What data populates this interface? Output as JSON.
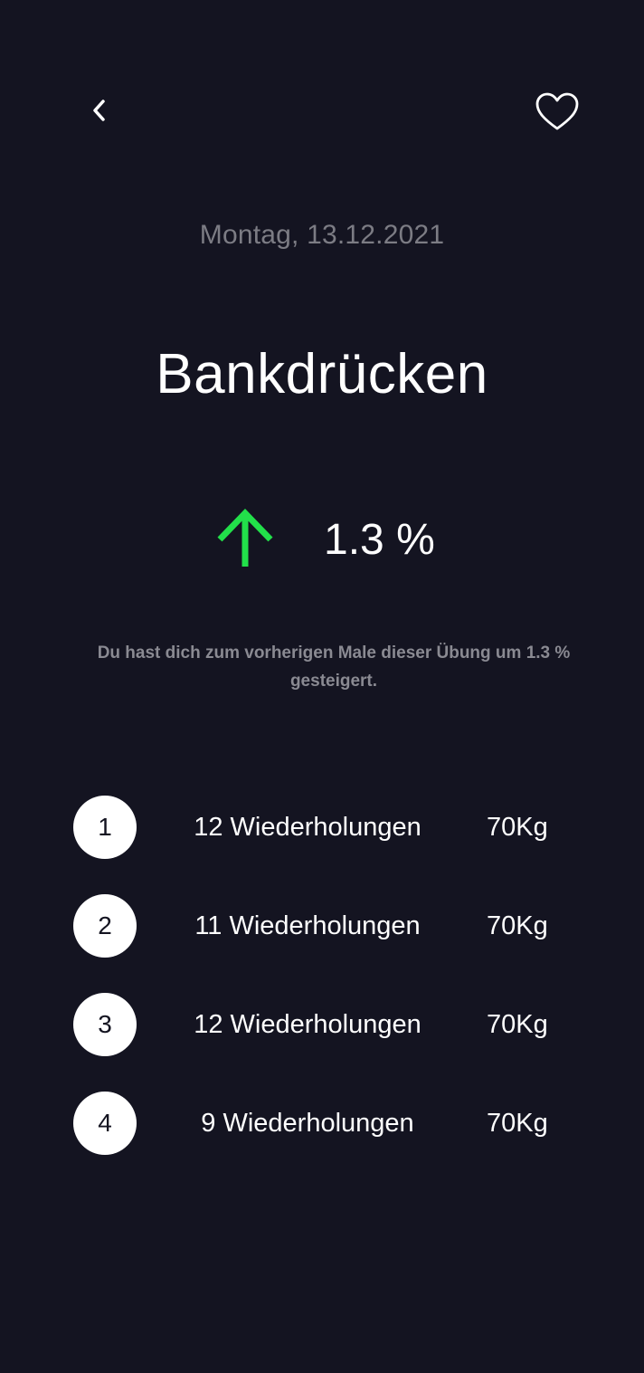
{
  "header": {
    "back_icon": "chevron-left-icon",
    "favorite_icon": "heart-outline-icon"
  },
  "date": "Montag, 13.12.2021",
  "exercise": {
    "title": "Bankdrücken"
  },
  "progress": {
    "icon": "arrow-up-icon",
    "icon_color": "#22e04a",
    "value": "1.3 %",
    "description": "Du hast dich zum vorherigen Male dieser Übung um 1.3 % gesteigert."
  },
  "sets": [
    {
      "number": "1",
      "reps": "12 Wiederholungen",
      "weight": "70Kg"
    },
    {
      "number": "2",
      "reps": "11 Wiederholungen",
      "weight": "70Kg"
    },
    {
      "number": "3",
      "reps": "12 Wiederholungen",
      "weight": "70Kg"
    },
    {
      "number": "4",
      "reps": "9 Wiederholungen",
      "weight": "70Kg"
    }
  ],
  "colors": {
    "background": "#141421",
    "accent": "#22e04a",
    "muted_text": "#7c7c84"
  }
}
